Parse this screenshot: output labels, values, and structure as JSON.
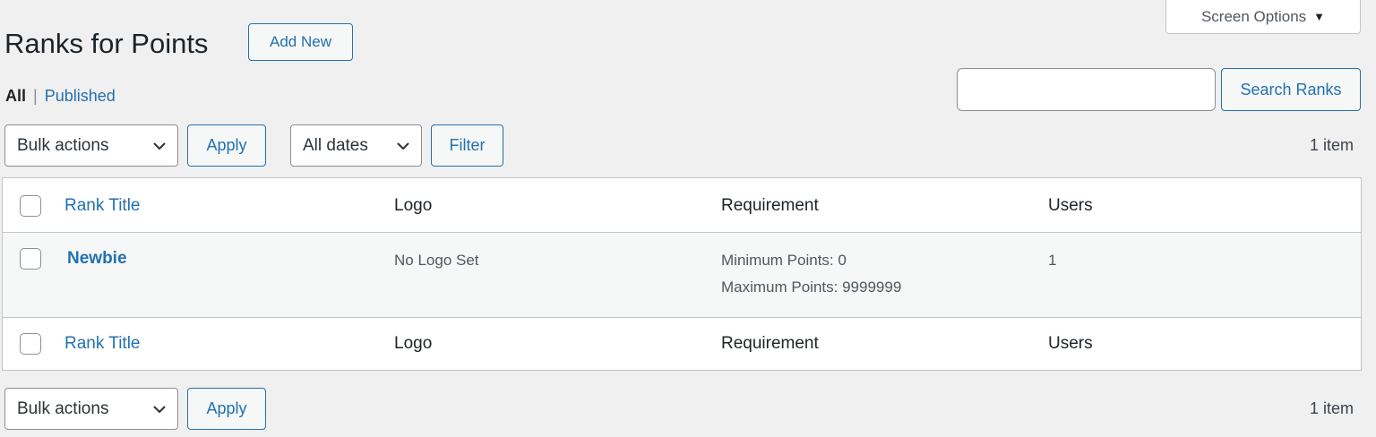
{
  "screen_options": {
    "label": "Screen Options",
    "arrow": "▼"
  },
  "header": {
    "title": "Ranks for Points",
    "add_new": "Add New"
  },
  "views": {
    "all": "All",
    "separator": "|",
    "published": "Published"
  },
  "search": {
    "value": "",
    "placeholder": "",
    "button": "Search Ranks"
  },
  "top_nav": {
    "bulk_actions": "Bulk actions",
    "apply": "Apply",
    "dates": "All dates",
    "filter": "Filter",
    "count": "1 item"
  },
  "bottom_nav": {
    "bulk_actions": "Bulk actions",
    "apply": "Apply",
    "count": "1 item"
  },
  "table": {
    "columns": [
      "Rank Title",
      "Logo",
      "Requirement",
      "Users"
    ],
    "rows": [
      {
        "title": "Newbie",
        "logo": "No Logo Set",
        "requirement_min": "Minimum Points: 0",
        "requirement_max": "Maximum Points: 9999999",
        "users": "1"
      }
    ]
  },
  "colors": {
    "accent": "#2271b1",
    "background": "#f0f0f1",
    "text": "#1d2327"
  },
  "icons": {
    "chevron": "chevron-down-icon"
  }
}
